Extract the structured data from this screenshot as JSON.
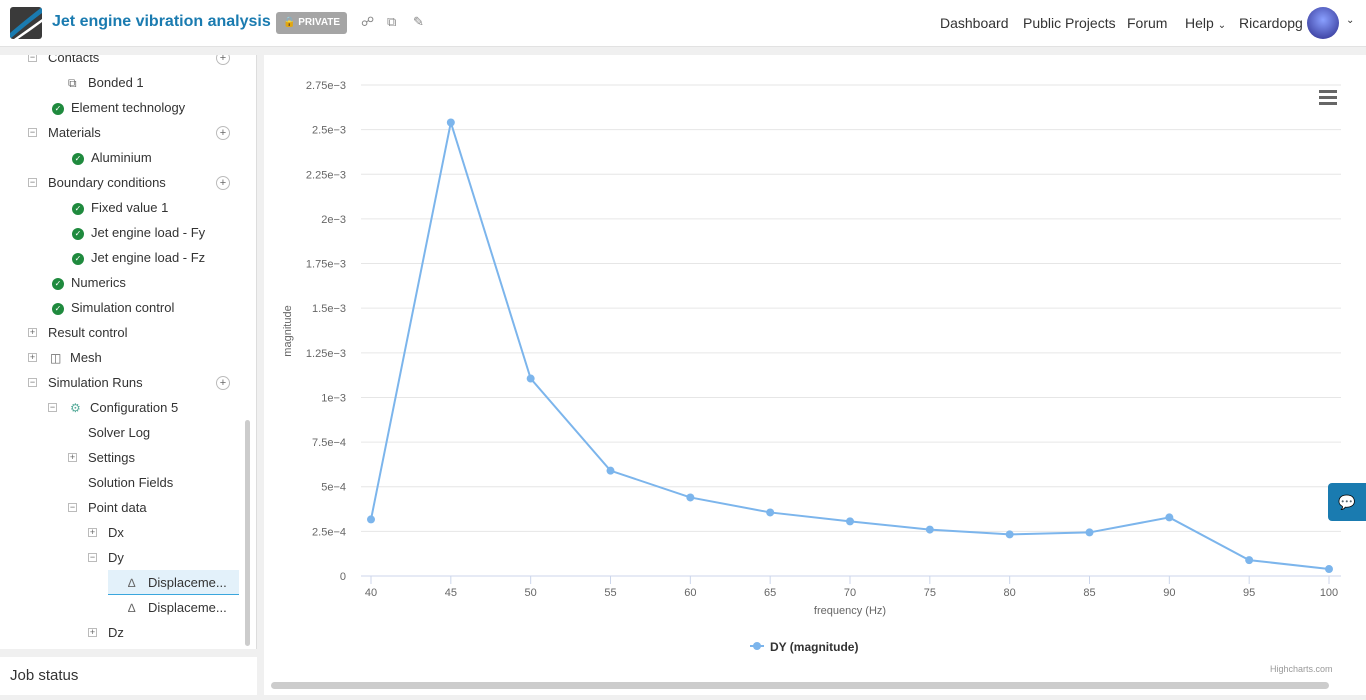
{
  "header": {
    "title": "Jet engine vibration analysis",
    "private_label": "PRIVATE",
    "nav": [
      "Dashboard",
      "Public Projects",
      "Forum",
      "Help"
    ],
    "user": "Ricardopg"
  },
  "tree": [
    {
      "label": "Contacts",
      "level": 0,
      "toggle": "-",
      "plus": true
    },
    {
      "label": "Bonded 1",
      "level": 1,
      "icon": "contact"
    },
    {
      "label": "Element technology",
      "level": 0,
      "icon": "check"
    },
    {
      "label": "Materials",
      "level": 0,
      "toggle": "-",
      "plus": true
    },
    {
      "label": "Aluminium",
      "level": 1,
      "icon": "check"
    },
    {
      "label": "Boundary conditions",
      "level": 0,
      "toggle": "-",
      "plus": true
    },
    {
      "label": "Fixed value 1",
      "level": 1,
      "icon": "check"
    },
    {
      "label": "Jet engine load - Fy",
      "level": 1,
      "icon": "check"
    },
    {
      "label": "Jet engine load - Fz",
      "level": 1,
      "icon": "check"
    },
    {
      "label": "Numerics",
      "level": 0,
      "icon": "check"
    },
    {
      "label": "Simulation control",
      "level": 0,
      "icon": "check"
    },
    {
      "label": "Result control",
      "level": 0,
      "toggle": "+"
    },
    {
      "label": "Mesh",
      "level": 0,
      "toggle": "+",
      "icon": "mesh"
    },
    {
      "label": "Simulation Runs",
      "level": 0,
      "toggle": "-",
      "plus": true
    },
    {
      "label": "Configuration 5",
      "level": 1,
      "toggle": "-",
      "icon": "gear"
    },
    {
      "label": "Solver Log",
      "level": 2
    },
    {
      "label": "Settings",
      "level": 2,
      "toggle": "+"
    },
    {
      "label": "Solution Fields",
      "level": 2
    },
    {
      "label": "Point data",
      "level": 2,
      "toggle": "-"
    },
    {
      "label": "Dx",
      "level": 3,
      "toggle": "+"
    },
    {
      "label": "Dy",
      "level": 3,
      "toggle": "-"
    },
    {
      "label": "Displaceme...",
      "level": 4,
      "icon": "chart",
      "selected": true
    },
    {
      "label": "Displaceme...",
      "level": 4,
      "icon": "chart"
    },
    {
      "label": "Dz",
      "level": 3,
      "toggle": "+"
    }
  ],
  "job_status": "Job status",
  "credits": "Highcharts.com",
  "chart_data": {
    "type": "line",
    "xlabel": "frequency (Hz)",
    "ylabel": "magnitude",
    "x": [
      40,
      45,
      50,
      55,
      60,
      65,
      70,
      75,
      80,
      85,
      90,
      95,
      100
    ],
    "series": [
      {
        "name": "DY (magnitude)",
        "color": "#7cb5ec",
        "values": [
          0.000317,
          0.00254,
          0.001106,
          0.00059,
          0.00044,
          0.000356,
          0.000306,
          0.00026,
          0.000233,
          0.000244,
          0.000328,
          8.9e-05,
          3.9e-05
        ]
      }
    ],
    "xlim": [
      40,
      100
    ],
    "ylim": [
      0,
      0.00275
    ],
    "xticks": [
      "40",
      "45",
      "50",
      "55",
      "60",
      "65",
      "70",
      "75",
      "80",
      "85",
      "90",
      "95",
      "100"
    ],
    "yticks": [
      "0",
      "2.5e−4",
      "5e−4",
      "7.5e−4",
      "1e−3",
      "1.25e−3",
      "1.5e−3",
      "1.75e−3",
      "2e−3",
      "2.25e−3",
      "2.5e−3",
      "2.75e−3"
    ],
    "grid": true,
    "legend": "bottom"
  }
}
